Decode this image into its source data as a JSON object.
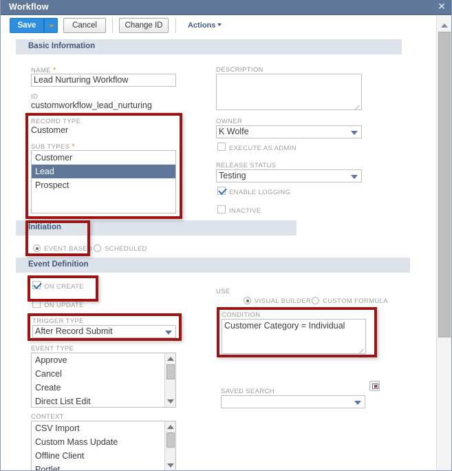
{
  "window": {
    "title": "Workflow",
    "close_icon": "close-icon",
    "close_glyph": "✕"
  },
  "toolbar": {
    "save_label": "Save",
    "save_caret_icon": "chevron-down-icon",
    "cancel_label": "Cancel",
    "change_id_label": "Change ID",
    "actions_label": "Actions"
  },
  "sections": {
    "basic_information": "Basic Information",
    "initiation": "Initiation",
    "event_definition": "Event Definition"
  },
  "basic_information": {
    "name": {
      "label": "NAME",
      "required": "*",
      "value": "Lead Nurturing Workflow"
    },
    "id": {
      "label": "ID",
      "value": "customworkflow_lead_nurturing"
    },
    "record_type": {
      "label": "RECORD TYPE",
      "value": "Customer"
    },
    "sub_types": {
      "label": "SUB TYPES",
      "required": "*",
      "options": [
        "Customer",
        "Lead",
        "Prospect"
      ],
      "selected": "Lead"
    },
    "description": {
      "label": "DESCRIPTION",
      "value": ""
    },
    "owner": {
      "label": "OWNER",
      "value": "K Wolfe"
    },
    "execute_as_admin": {
      "label": "EXECUTE AS ADMIN",
      "checked": false
    },
    "release_status": {
      "label": "RELEASE STATUS",
      "value": "Testing"
    },
    "enable_logging": {
      "label": "ENABLE LOGGING",
      "checked": true
    },
    "inactive": {
      "label": "INACTIVE",
      "checked": false
    }
  },
  "initiation": {
    "event_based": {
      "label": "EVENT BASED",
      "selected": true
    },
    "scheduled": {
      "label": "SCHEDULED",
      "selected": false
    }
  },
  "event_definition": {
    "on_create": {
      "label": "ON CREATE",
      "checked": true
    },
    "on_update": {
      "label": "ON UPDATE",
      "checked": false
    },
    "trigger_type": {
      "label": "TRIGGER TYPE",
      "value": "After Record Submit"
    },
    "event_type": {
      "label": "EVENT TYPE",
      "options": [
        "Approve",
        "Cancel",
        "Create",
        "Direct List Edit"
      ]
    },
    "context": {
      "label": "CONTEXT",
      "options": [
        "CSV Import",
        "Custom Mass Update",
        "Offline Client",
        "Portlet"
      ]
    },
    "use": {
      "label": "USE",
      "visual_builder": {
        "label": "VISUAL BUILDER",
        "selected": true
      },
      "custom_formula": {
        "label": "CUSTOM FORMULA",
        "selected": false
      }
    },
    "condition": {
      "label": "CONDITION",
      "value": "Customer Category = Individual",
      "icon": "formula-builder-icon"
    },
    "saved_search": {
      "label": "SAVED SEARCH",
      "value": ""
    }
  },
  "colors": {
    "titlebar": "#5f7899",
    "section_bar": "#dde3eb",
    "primary_button": "#2e8fdf",
    "highlight_box": "#9b1515",
    "selected_option": "#5f7899",
    "required_marker": "#d79435"
  }
}
